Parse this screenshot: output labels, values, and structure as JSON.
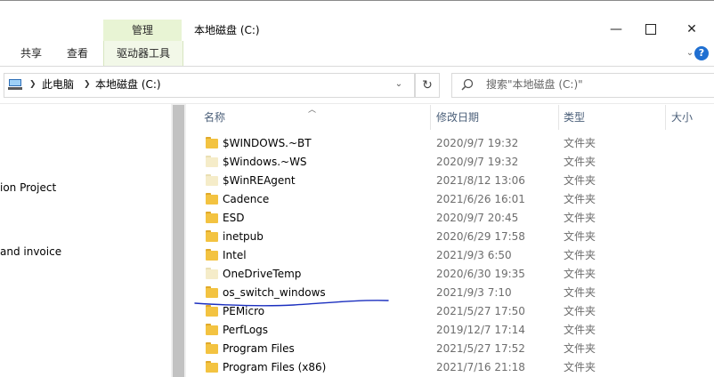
{
  "ribbon": {
    "context_group": "管理",
    "window_title": "本地磁盘 (C:)",
    "tabs": {
      "share": "共享",
      "view": "查看",
      "drive_tools": "驱动器工具"
    },
    "window_controls": {
      "minimize": "—",
      "maximize": "",
      "close": "✕"
    },
    "help_icon": "?"
  },
  "address_bar": {
    "breadcrumb": [
      "此电脑",
      "本地磁盘 (C:)"
    ],
    "separator": "❯",
    "dropdown": "⌄",
    "refresh": "↻"
  },
  "search": {
    "placeholder": "搜索\"本地磁盘 (C:)\""
  },
  "nav_pane": {
    "items": [
      "ion Project",
      "and invoice"
    ]
  },
  "columns": {
    "name": "名称",
    "date": "修改日期",
    "type": "类型",
    "size": "大小"
  },
  "files": [
    {
      "name": "$WINDOWS.~BT",
      "date": "2020/9/7 19:32",
      "type": "文件夹",
      "style": "normal"
    },
    {
      "name": "$Windows.~WS",
      "date": "2020/9/7 19:32",
      "type": "文件夹",
      "style": "hidden"
    },
    {
      "name": "$WinREAgent",
      "date": "2021/8/12 13:06",
      "type": "文件夹",
      "style": "hidden"
    },
    {
      "name": "Cadence",
      "date": "2021/6/26 16:01",
      "type": "文件夹",
      "style": "normal"
    },
    {
      "name": "ESD",
      "date": "2020/9/7 20:45",
      "type": "文件夹",
      "style": "normal"
    },
    {
      "name": "inetpub",
      "date": "2020/6/29 17:58",
      "type": "文件夹",
      "style": "normal"
    },
    {
      "name": "Intel",
      "date": "2021/9/3 6:50",
      "type": "文件夹",
      "style": "normal"
    },
    {
      "name": "OneDriveTemp",
      "date": "2020/6/30 19:35",
      "type": "文件夹",
      "style": "hidden"
    },
    {
      "name": "os_switch_windows",
      "date": "2021/9/3 7:10",
      "type": "文件夹",
      "style": "normal"
    },
    {
      "name": "PEMicro",
      "date": "2021/5/27 17:50",
      "type": "文件夹",
      "style": "normal"
    },
    {
      "name": "PerfLogs",
      "date": "2019/12/7 17:14",
      "type": "文件夹",
      "style": "normal"
    },
    {
      "name": "Program Files",
      "date": "2021/5/27 17:52",
      "type": "文件夹",
      "style": "normal"
    },
    {
      "name": "Program Files (x86)",
      "date": "2021/7/16 21:18",
      "type": "文件夹",
      "style": "normal"
    }
  ],
  "colors": {
    "folder": "#f3c341",
    "folder_tab": "#e0a92a",
    "folder_hidden": "#f5ecc9",
    "folder_hidden_tab": "#eadfb3",
    "annotation": "#1b2fbf",
    "context_group": "#e8f4d4"
  },
  "icons": {
    "pc": "computer-icon",
    "search": "search-icon",
    "folder": "folder-icon",
    "refresh": "refresh-icon"
  }
}
